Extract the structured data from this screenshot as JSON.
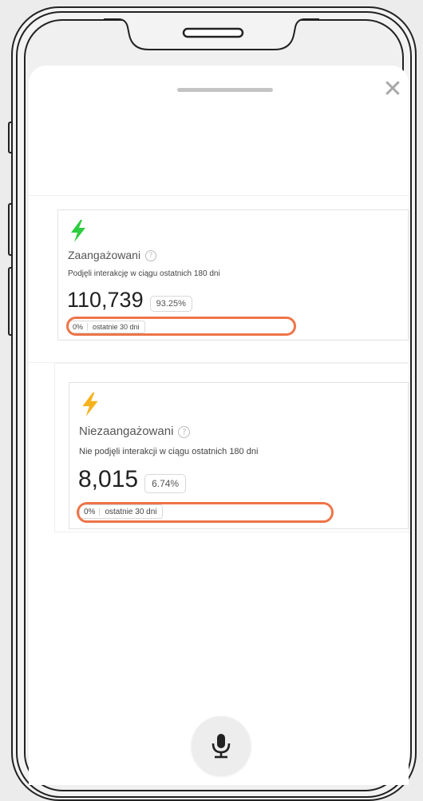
{
  "sheet": {
    "close_glyph": "✕"
  },
  "cards": {
    "engaged": {
      "icon": "bolt-green-icon",
      "icon_color": "#2ecc40",
      "title": "Zaangażowani",
      "description": "Podjęli interakcję w ciągu ostatnich 180 dni",
      "count": "110,739",
      "percent": "93.25%",
      "change_percent": "0%",
      "change_period": "ostatnie 30 dni"
    },
    "disengaged": {
      "icon": "bolt-orange-icon",
      "icon_color": "#f5b21b",
      "title": "Niezaangażowani",
      "description": "Nie podjęli interakcji w ciągu ostatnich 180 dni",
      "count": "8,015",
      "percent": "6.74%",
      "change_percent": "0%",
      "change_period": "ostatnie 30 dni"
    }
  },
  "highlight_color": "#ee7448",
  "mic": {
    "icon": "microphone-icon"
  }
}
